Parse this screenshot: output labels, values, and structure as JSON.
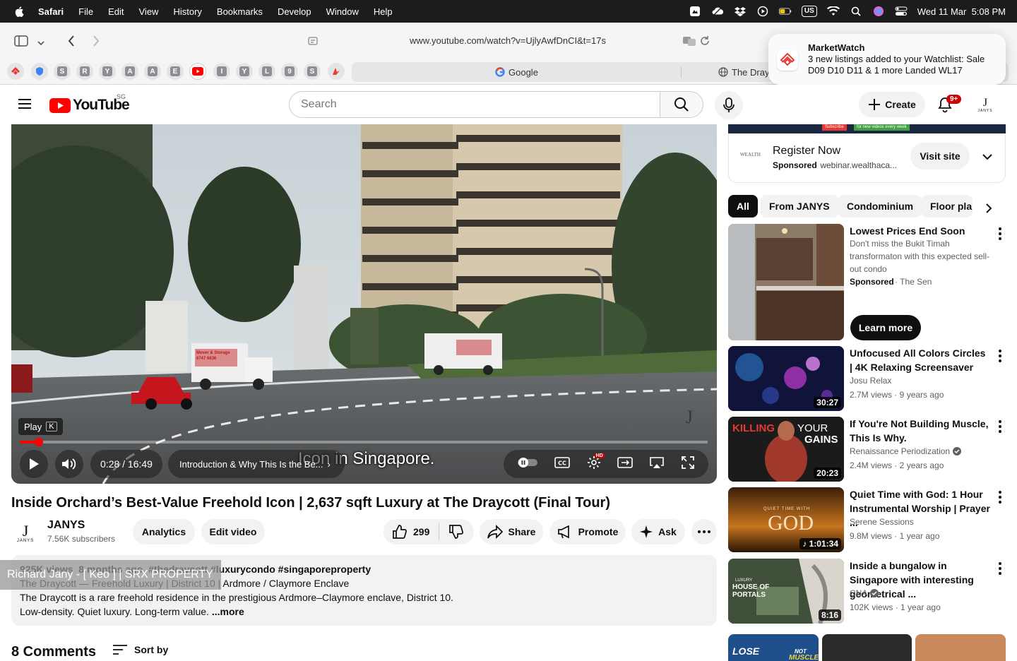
{
  "menubar": {
    "items": [
      "Safari",
      "File",
      "Edit",
      "View",
      "History",
      "Bookmarks",
      "Develop",
      "Window",
      "Help"
    ],
    "keyboard_layout": "US",
    "clock": "Wed 11 Mar  5:08 PM"
  },
  "safari": {
    "url": "www.youtube.com/watch?v=UjlyAwfDnCI&t=17s",
    "pinned_tab_letters": [
      "S",
      "R",
      "Y",
      "A",
      "A",
      "E",
      "I",
      "Y",
      "L",
      "9",
      "S"
    ],
    "tab_google": "Google",
    "tab_draycott": "The Dray"
  },
  "notification": {
    "app": "MarketWatch",
    "line1": "3 new listings added to your Watchlist: Sale",
    "line2": "D09 D10 D11 & 1 more Landed WL17"
  },
  "youtube": {
    "logo_text": "YouTube",
    "region": "SG",
    "search_placeholder": "Search",
    "create_label": "Create",
    "notif_count": "9+",
    "avatar_letters": "JANYS"
  },
  "player": {
    "play_tooltip": "Play",
    "play_key": "K",
    "time": "0:28 / 16:49",
    "chapter": "Introduction & Why This Is the Be...",
    "chapter_arrow": "›",
    "caption": "Icon in Singapore.",
    "progress_fraction": 0.028,
    "hd_badge": "HD",
    "watermark": "J",
    "van_sign": "Mover & Storage 6747 6636"
  },
  "video": {
    "title": "Inside Orchard’s Best-Value Freehold Icon | 2,637 sqft Luxury at The Draycott (Final Tour)",
    "channel": "JANYS",
    "subscribers": "7.56K subscribers",
    "analytics_label": "Analytics",
    "edit_label": "Edit video",
    "likes": "299",
    "share_label": "Share",
    "promote_label": "Promote",
    "ask_label": "Ask",
    "stats": "925K views  8 months ago  #thedraycott #luxurycondo #singaporeproperty",
    "desc_line1": "The Draycott — Freehold Luxury | District 10 | Ardmore / Claymore Enclave",
    "desc_line2": "The Draycott is a rare freehold residence in the prestigious Ardmore–Claymore enclave, District 10.",
    "desc_line3": "Low-density. Quiet luxury. Long-term value.",
    "more_label": "...more",
    "overlay_label": "Richard Jany - [ Keo ] | SRX PROPERTY",
    "comments_count": "8 Comments",
    "sort_label": "Sort by"
  },
  "ad": {
    "title": "Register Now",
    "sponsored": "Sponsored",
    "domain": "· webinar.wealthaca...",
    "visit_label": "Visit site",
    "logo_text": "WEALTH",
    "banner_subscribe": "Subscribe",
    "banner_text": "for new videos every week"
  },
  "chips": [
    "All",
    "From JANYS",
    "Condominium",
    "Floor plan"
  ],
  "recommendations": [
    {
      "title": "Lowest Prices End Soon",
      "line2": "Don't miss the Bukit Timah",
      "line3": "transformaton with this expected sell-",
      "line4": "out condo",
      "sponsored": "Sponsored",
      "source": "· The Sen",
      "cta": "Learn more"
    },
    {
      "title": "Unfocused All Colors Circles | 4K Relaxing Screensaver",
      "channel": "Josu Relax",
      "meta": "2.7M views · 9 years ago",
      "duration": "30:27"
    },
    {
      "title": "If You're Not Building Muscle, This Is Why.",
      "channel": "Renaissance Periodization",
      "meta": "2.4M views · 2 years ago",
      "duration": "20:23",
      "thumb_text_a": "KILLING",
      "thumb_text_b": "YOUR",
      "thumb_text_c": "GAINS"
    },
    {
      "title": "Quiet Time with God: 1 Hour Instrumental Worship | Prayer ...",
      "channel": "Serene Sessions",
      "meta": "9.8M views · 1 year ago",
      "duration": "♪ 1:01:34",
      "thumb_text_a": "QUIET TIME WITH",
      "thumb_text_b": "GOD"
    },
    {
      "title": "Inside a bungalow in Singapore with interesting geometrical ...",
      "channel": "CNA",
      "meta": "102K views · 1 year ago",
      "duration": "8:16",
      "thumb_text_a": "LUXURY",
      "thumb_text_b": "HOUSE OF",
      "thumb_text_c": "PORTALS"
    }
  ],
  "bottom_thumbs": {
    "a": "LOSE",
    "b": "NOT",
    "c": "MUSCLE"
  },
  "colors": {
    "youtube_red": "#ff0000",
    "menubar": "#1c1c1e",
    "chip_active": "#0f0f0f",
    "notif_badge": "#cc0000"
  }
}
